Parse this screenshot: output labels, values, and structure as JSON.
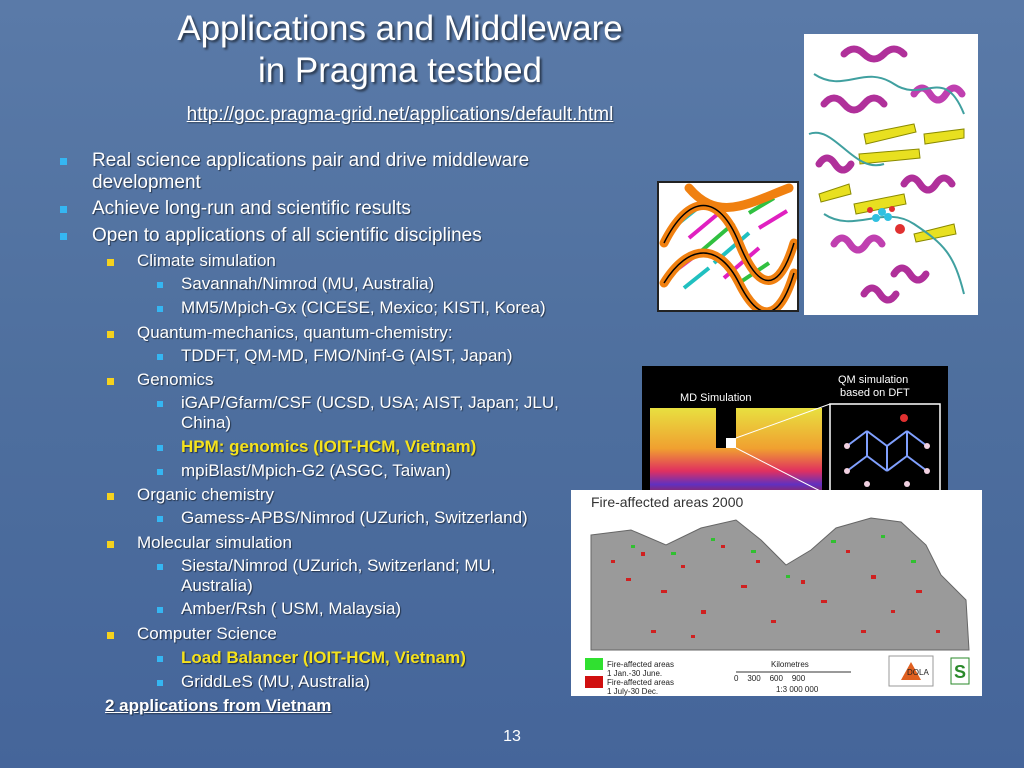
{
  "slide": {
    "title_line1": "Applications and Middleware",
    "title_line2": "in Pragma testbed",
    "url": "http://goc.pragma-grid.net/applications/default.html",
    "page_number": "13",
    "footer_link": "2 applications from Vietnam"
  },
  "bullets": [
    {
      "level": 1,
      "text": "Real science applications pair and drive middleware development"
    },
    {
      "level": 1,
      "text": "Achieve long-run and scientific results"
    },
    {
      "level": 1,
      "text": "Open to applications of all scientific disciplines"
    },
    {
      "level": 2,
      "text": "Climate simulation"
    },
    {
      "level": 3,
      "text": "Savannah/Nimrod (MU, Australia)"
    },
    {
      "level": 3,
      "text": "MM5/Mpich-Gx (CICESE, Mexico; KISTI, Korea)"
    },
    {
      "level": 2,
      "text": "Quantum-mechanics, quantum-chemistry:"
    },
    {
      "level": 3,
      "text": "TDDFT, QM-MD, FMO/Ninf-G (AIST, Japan)"
    },
    {
      "level": 2,
      "text": "Genomics"
    },
    {
      "level": 3,
      "text": "iGAP/Gfarm/CSF (UCSD, USA; AIST, Japan; JLU, China)"
    },
    {
      "level": 3,
      "text": "HPM: genomics (IOIT-HCM, Vietnam)",
      "highlight": true
    },
    {
      "level": 3,
      "text": "mpiBlast/Mpich-G2 (ASGC, Taiwan)"
    },
    {
      "level": 2,
      "text": "Organic chemistry"
    },
    {
      "level": 3,
      "text": "Gamess-APBS/Nimrod (UZurich, Switzerland)"
    },
    {
      "level": 2,
      "text": "Molecular simulation"
    },
    {
      "level": 3,
      "text": "Siesta/Nimrod (UZurich, Switzerland; MU, Australia)"
    },
    {
      "level": 3,
      "text": "Amber/Rsh ( USM, Malaysia)"
    },
    {
      "level": 2,
      "text": "Computer Science"
    },
    {
      "level": 3,
      "text": "Load Balancer (IOIT-HCM, Vietnam)",
      "highlight": true
    },
    {
      "level": 3,
      "text": "GriddLeS (MU, Australia)"
    }
  ],
  "images": {
    "md_label": "MD Simulation",
    "qm_label_1": "QM simulation",
    "qm_label_2": "based on DFT",
    "map_title": "Fire-affected areas 2000",
    "legend_1_line1": "Fire-affected areas",
    "legend_1_line2": "1 Jan.-30 June.",
    "legend_2_line1": "Fire-affected areas",
    "legend_2_line2": "1 July-30 Dec.",
    "scale_label": "Kilometres",
    "scale_ticks": "0    300    600    900",
    "scale_ratio": "1:3 000 000",
    "dola_label": "DOLA",
    "accent_blue": "#35b6f2",
    "accent_yellow": "#f5d21e"
  }
}
